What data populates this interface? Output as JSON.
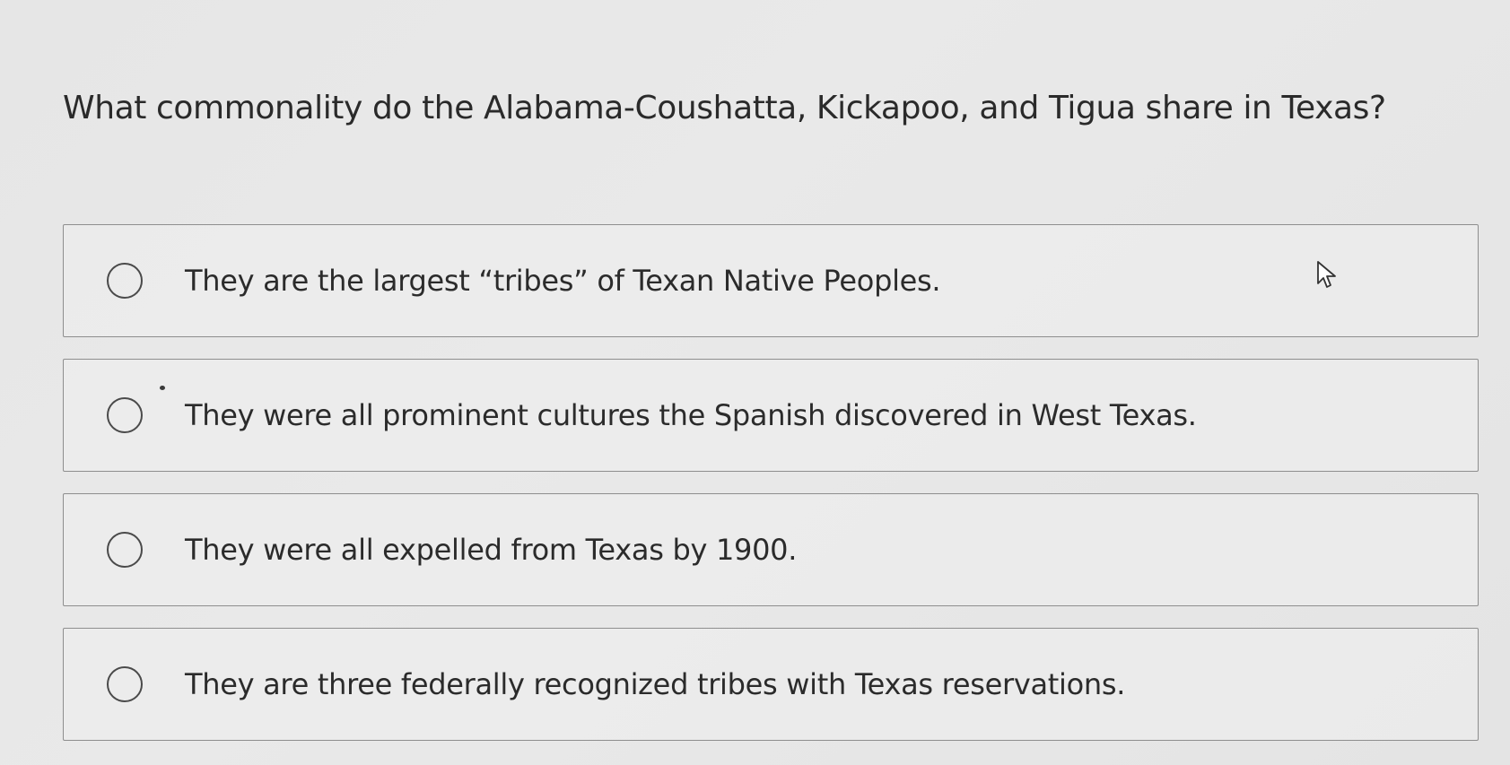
{
  "question": {
    "text": "What commonality do the Alabama-Coushatta, Kickapoo, and Tigua share in Texas?"
  },
  "options": [
    {
      "label": "They are the largest “tribes” of Texan Native Peoples."
    },
    {
      "label": "They were all prominent cultures the Spanish discovered in West Texas."
    },
    {
      "label": "They were all expelled from Texas by 1900."
    },
    {
      "label": "They are three federally recognized tribes with Texas reservations."
    }
  ],
  "icons": {
    "cursor": "mouse-pointer-icon",
    "radio": "radio-unselected-icon"
  },
  "colors": {
    "background": "#e7e7e7",
    "border": "#8e8e8e",
    "text": "#2b2b2b"
  }
}
